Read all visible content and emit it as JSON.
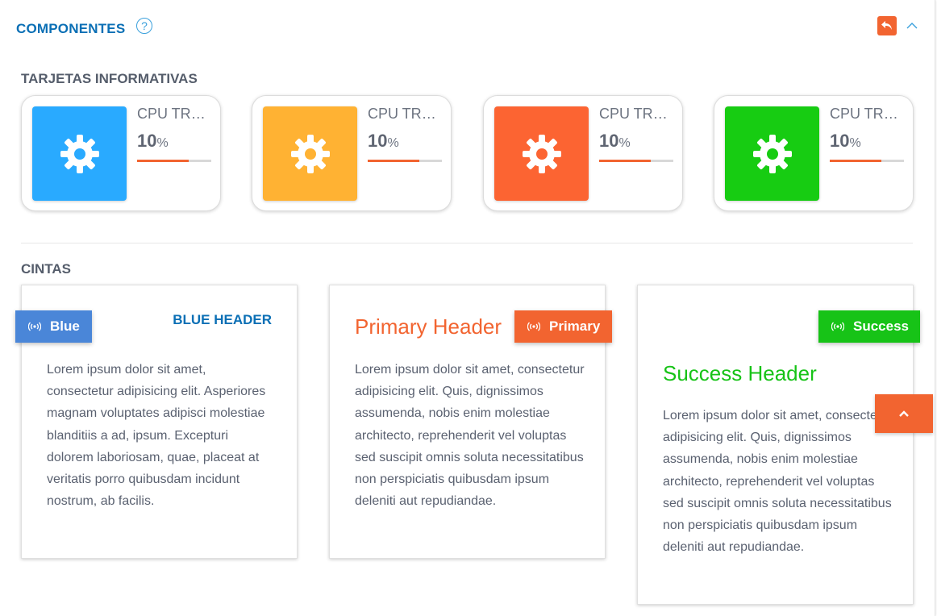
{
  "header": {
    "title": "COMPONENTES",
    "help_glyph": "?",
    "icons": [
      "help-icon",
      "reply-icon",
      "chevron-up-icon"
    ],
    "reply_button_color": "#f26430"
  },
  "info_section": {
    "title": "TARJETAS INFORMATIVAS",
    "cards": [
      {
        "label": "CPU TRAFFIC",
        "value": "10",
        "unit": "%",
        "progress": 0.7,
        "color": "#29aaff",
        "icon": "gear-icon"
      },
      {
        "label": "CPU TRAFFIC",
        "value": "10",
        "unit": "%",
        "progress": 0.7,
        "color": "#ffb233",
        "icon": "gear-icon"
      },
      {
        "label": "CPU TRAFFIC",
        "value": "10",
        "unit": "%",
        "progress": 0.7,
        "color": "#fc6432",
        "icon": "gear-icon"
      },
      {
        "label": "CPU TRAFFIC",
        "value": "10",
        "unit": "%",
        "progress": 0.7,
        "color": "#17cc12",
        "icon": "gear-icon"
      }
    ]
  },
  "ribbon_section": {
    "title": "CINTAS",
    "cards": [
      {
        "ribbon_label": "Blue",
        "ribbon_color": "#4a86d8",
        "header": "BLUE HEADER",
        "header_color": "#0a6fb5",
        "body": "Lorem ipsum dolor sit amet, consectetur adipisicing elit. Asperiores magnam voluptates adipisci molestiae blanditiis a ad, ipsum. Excepturi dolorem laboriosam, quae, placeat at veritatis porro quibusdam incidunt nostrum, ab facilis."
      },
      {
        "ribbon_label": "Primary",
        "ribbon_color": "#f26430",
        "header": "Primary Header",
        "header_color": "#f26430",
        "body": "Lorem ipsum dolor sit amet, consectetur adipisicing elit. Quis, dignissimos assumenda, nobis enim molestiae architecto, reprehenderit vel voluptas sed suscipit omnis soluta necessitatibus non perspiciatis quibusdam ipsum deleniti aut repudiandae."
      },
      {
        "ribbon_label": "Success",
        "ribbon_color": "#17c317",
        "header": "Success Header",
        "header_color": "#17c317",
        "body": "Lorem ipsum dolor sit amet, consectetur adipisicing elit. Quis, dignissimos assumenda, nobis enim molestiae architecto, reprehenderit vel voluptas sed suscipit omnis soluta necessitatibus non perspiciatis quibusdam ipsum deleniti aut repudiandae."
      }
    ]
  },
  "scroll_top": {
    "icon": "chevron-up-icon",
    "color": "#f26430"
  }
}
